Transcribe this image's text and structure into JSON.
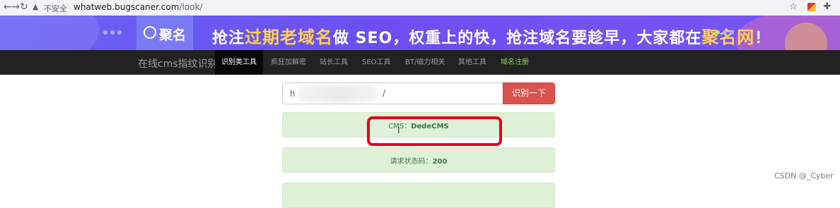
{
  "browser": {
    "security_label": "不安全",
    "url_host": "whatweb.bugscaner.com",
    "url_path": "/look/",
    "icons": [
      "back-icon",
      "forward-icon",
      "reload-icon",
      "warning-icon",
      "star-icon",
      "extension-icon",
      "puzzle-icon"
    ]
  },
  "banner": {
    "logo_text": "聚名",
    "slogan_parts": [
      "抢注",
      "过期老域名",
      "做 SEO，权重上的快，抢注域名要趁早，大家都在",
      "聚名网",
      "！"
    ]
  },
  "nav": {
    "brand": "在线cms指纹识别",
    "items": [
      {
        "label": "识别类工具"
      },
      {
        "label": "疯狂加解密"
      },
      {
        "label": "站长工具"
      },
      {
        "label": "SEO工具"
      },
      {
        "label": "BT/磁力相关"
      },
      {
        "label": "其他工具"
      },
      {
        "label": "域名注册"
      }
    ]
  },
  "search": {
    "value_start": "h",
    "value_end": "/",
    "button_label": "识别一下"
  },
  "results": [
    {
      "label": "CMS：",
      "value": "DedeCMS"
    },
    {
      "label": "请求状态码：",
      "value": "200"
    }
  ],
  "watermark": "CSDN @_Cyber",
  "colors": {
    "accent": "#d9534f",
    "success_bg": "#dff0d8",
    "success_text": "#3c763d",
    "annotation": "#e5001a"
  }
}
